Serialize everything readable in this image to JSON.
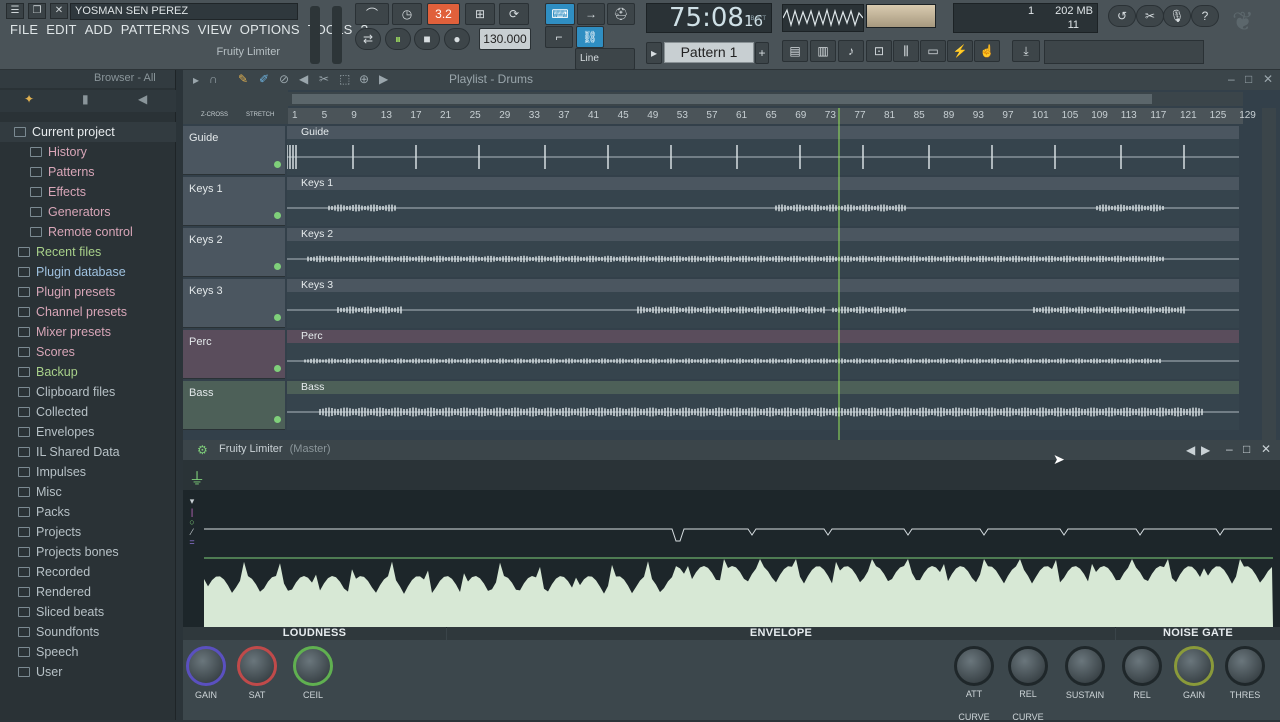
{
  "window": {
    "title": "YOSMAN SEN PEREZ"
  },
  "menu": [
    "FILE",
    "EDIT",
    "ADD",
    "PATTERNS",
    "VIEW",
    "OPTIONS",
    "TOOLS",
    "?"
  ],
  "hint": "Fruity Limiter",
  "transport": {
    "tempo": "130.000",
    "time_main": "75:08",
    "time_sub": "16",
    "time_tag": "B:S:T",
    "snap": "Line",
    "pattern": "Pattern 1",
    "highlight": "3.2"
  },
  "meters": {
    "memory": "202 MB",
    "cpu": "1",
    "polyphony": "11"
  },
  "browser": {
    "header": "Browser - All",
    "items": [
      {
        "label": "Current project",
        "style": "current"
      },
      {
        "label": "History",
        "style": "sub"
      },
      {
        "label": "Patterns",
        "style": "sub"
      },
      {
        "label": "Effects",
        "style": "sub"
      },
      {
        "label": "Generators",
        "style": "sub"
      },
      {
        "label": "Remote control",
        "style": "sub"
      },
      {
        "label": "Recent files",
        "style": "green"
      },
      {
        "label": "Plugin database",
        "style": "blue"
      },
      {
        "label": "Plugin presets",
        "style": "pink"
      },
      {
        "label": "Channel presets",
        "style": "pink"
      },
      {
        "label": "Mixer presets",
        "style": "pink"
      },
      {
        "label": "Scores",
        "style": "pink"
      },
      {
        "label": "Backup",
        "style": "green"
      },
      {
        "label": "Clipboard files",
        "style": "grey"
      },
      {
        "label": "Collected",
        "style": "grey"
      },
      {
        "label": "Envelopes",
        "style": "grey"
      },
      {
        "label": "IL Shared Data",
        "style": "grey"
      },
      {
        "label": "Impulses",
        "style": "grey"
      },
      {
        "label": "Misc",
        "style": "grey"
      },
      {
        "label": "Packs",
        "style": "grey"
      },
      {
        "label": "Projects",
        "style": "grey"
      },
      {
        "label": "Projects bones",
        "style": "grey"
      },
      {
        "label": "Recorded",
        "style": "grey"
      },
      {
        "label": "Rendered",
        "style": "grey"
      },
      {
        "label": "Sliced beats",
        "style": "grey"
      },
      {
        "label": "Soundfonts",
        "style": "grey"
      },
      {
        "label": "Speech",
        "style": "grey"
      },
      {
        "label": "User",
        "style": "grey"
      }
    ]
  },
  "playlist": {
    "title": "Playlist - Drums",
    "zcross": "Z-CROSS",
    "stretch": "STRETCH",
    "ruler": [
      "1",
      "5",
      "9",
      "13",
      "17",
      "21",
      "25",
      "29",
      "33",
      "37",
      "41",
      "45",
      "49",
      "53",
      "57",
      "61",
      "65",
      "69",
      "73",
      "77",
      "81",
      "85",
      "89",
      "93",
      "97",
      "101",
      "105",
      "109",
      "113",
      "117",
      "121",
      "125",
      "129"
    ],
    "tracks": [
      {
        "name": "Guide",
        "clip": "Guide",
        "color": "#4b5660"
      },
      {
        "name": "Keys 1",
        "clip": "Keys 1",
        "color": "#4b5660"
      },
      {
        "name": "Keys 2",
        "clip": "Keys 2",
        "color": "#4b5660"
      },
      {
        "name": "Keys 3",
        "clip": "Keys 3",
        "color": "#4b5660"
      },
      {
        "name": "Perc",
        "clip": "Perc",
        "color": "#5a4d5c"
      },
      {
        "name": "Bass",
        "clip": "Bass",
        "color": "#4d6058"
      }
    ]
  },
  "plugin": {
    "title": "Fruity Limiter",
    "subtitle": "(Master)",
    "sections": {
      "loudness": "LOUDNESS",
      "envelope": "ENVELOPE",
      "gate": "NOISE GATE"
    },
    "knobs": [
      "GAIN",
      "SAT",
      "CEIL",
      "ATT",
      "REL",
      "SUSTAIN",
      "REL",
      "GAIN",
      "THRES"
    ],
    "curve1": "CURVE",
    "curve2": "CURVE"
  }
}
